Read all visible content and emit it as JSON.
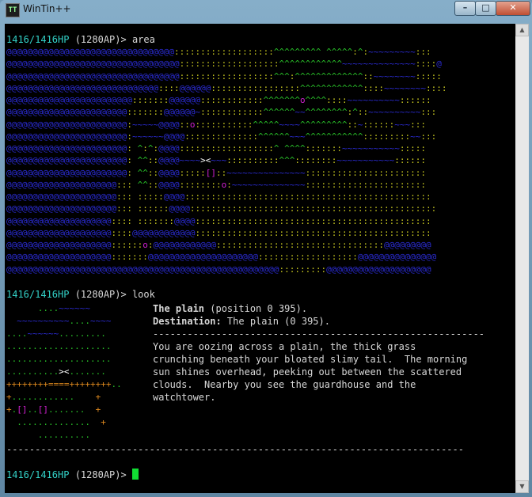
{
  "window": {
    "title": "WinTin++",
    "icon_text": "TT"
  },
  "controls": {
    "minimize": "–",
    "maximize": "□",
    "close": "✕"
  },
  "colors": {
    "hp": "#33d2c8",
    "water": "#2a2bd0",
    "grass": "#29c229",
    "road": "#c8c820",
    "marker": "#d020d0",
    "cursor": "#11dd33"
  },
  "prompts": {
    "p1_hp": "1416/1416HP",
    "p1_rest": " (1280AP)> area",
    "p2_hp": "1416/1416HP",
    "p2_rest": " (1280AP)> look",
    "p3_hp": "1416/1416HP",
    "p3_rest": " (1280AP)> "
  },
  "area_map": [
    "@@@@@@@@@@@@@@@@@@@@@@@@@@@@@@@@:::::::::::::::::::^^^^^^^^^ ^^^^^:^:~~~~~~~~~:::",
    "@@@@@@@@@@@@@@@@@@@@@@@@@@@@@@@@@:::::::::::::::::::^^^^^^^^^^^^~~~~~~~~~~~~~~::::@",
    "@@@@@@@@@@@@@@@@@@@@@@@@@@@@@@@@@::::::::::::::::::^^^:^^^^^^^^^^^^^::~~~~~~~~:::::",
    "@@@@@@@@@@@@@@@@@@@@@@@@@@@@@::::@@@@@@:::::::::::::::::^^^^^^^^^^^^::::~~~~~~~~::::",
    "@@@@@@@@@@@@@@@@@@@@@@@@:::::::@@@@@@::::::::::::^^^^^^^o^^^^::::~~~~~~~~~~::::::",
    "@@@@@@@@@@@@@@@@@@@@@@@:::::::@@@@@@~::::::::::::^^^^^^~~^^^^^^^^:^::~~~~~~~~~~:::",
    "@@@@@@@@@@@@@@@@@@@@@@@:~~~~~@@@@::o:::::::::::^^^^^~~~~^^^^^^^^^::~::::::~~~:::",
    "@@@@@@@@@@@@@@@@@@@@@@@:~~~~~~@@@@::::::::::::::^^^^^^~~~^^^^^^^^^^^:::::::::~~:::",
    "@@@@@@@@@@@@@@@@@@@@@@@: ^:^:@@@@::::::::::::::::::^ ^^^^:::::::~~~~~~~~~~~:::::",
    "@@@@@@@@@@@@@@@@@@@@@@@: ^^::@@@@~~~~><~~~::::::::::^^^::::::::~~~~~~~~~~~::::::",
    "@@@@@@@@@@@@@@@@@@@@@@@: ^^::@@@@:::::[]::~~~~~~~~~~~~~~~:::::::::::::::::::::::",
    "@@@@@@@@@@@@@@@@@@@@@::: ^^::@@@@::::::::o:~~~~~~~~~~~~~~:::::::::::::::::::::::",
    "@@@@@@@@@@@@@@@@@@@@@::: :::::@@@@:::::::::::::::::::::::::::::::::::::::::::::::",
    "@@@@@@@@@@@@@@@@@@@@@::: ::::::@@@@:::::::::::::::::::::::::::::::::::::::::::::::",
    "@@@@@@@@@@@@@@@@@@@@:::: :::::::@@@@:::::::::::::::::::::::::::::::::::::::::::::",
    "@@@@@@@@@@@@@@@@@@@@::::@@@@@@@@@@@@:::::::::::::::::::::::::::::::::::::::::::::",
    "@@@@@@@@@@@@@@@@@@@@::::::o:@@@@@@@@@@@@::::::::::::::::::::::::::::::::@@@@@@@@@",
    "@@@@@@@@@@@@@@@@@@@@:::::::@@@@@@@@@@@@@@@@@@@@@:::::::::::::::::::@@@@@@@@@@@@@@@",
    "@@@@@@@@@@@@@@@@@@@@@@@@@@@@@@@@@@@@@@@@@@@@@@@@@@@@:::::::::@@@@@@@@@@@@@@@@@@@@"
  ],
  "minimap": [
    "      ....~~~~~~",
    "  ~~~~~~~~~~....~~~~",
    "....~~~~~~.........",
    "....................",
    "....................",
    "..........><.......",
    "++++++++====++++++++..",
    "+............    +",
    "+.[]..[].......  +",
    "  ..............  +",
    "      .........."
  ],
  "look": {
    "room_name": "The plain",
    "position": " (position 0 395).",
    "destination_label": "Destination:",
    "destination_value": " The plain (0 395).",
    "separator": "----------------------------------------------------------",
    "description": [
      "You are oozing across a plain, the thick grass",
      "crunching beneath your bloated slimy tail.  The morning",
      "sun shines overhead, peeking out between the scattered",
      "clouds.  Nearby you see the guardhouse and the",
      "watchtower."
    ]
  },
  "bottom_rule": "--------------------------------------------------------------------------------"
}
